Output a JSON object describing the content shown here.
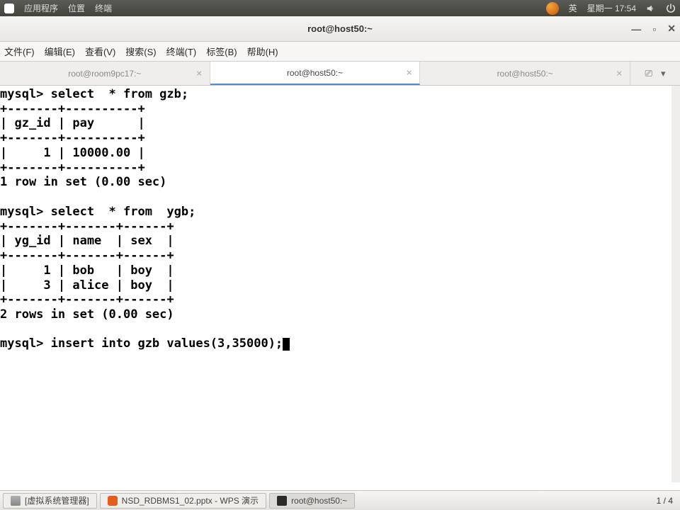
{
  "top_panel": {
    "apps": "应用程序",
    "places": "位置",
    "terminal": "终端",
    "ime": "英",
    "datetime": "星期一 17:54"
  },
  "window": {
    "title": "root@host50:~"
  },
  "menus": {
    "file": "文件(F)",
    "edit": "编辑(E)",
    "view": "查看(V)",
    "search": "搜索(S)",
    "terminal": "终端(T)",
    "tabs": "标签(B)",
    "help": "帮助(H)"
  },
  "tabs": [
    {
      "label": "root@room9pc17:~",
      "active": false
    },
    {
      "label": "root@host50:~",
      "active": true
    },
    {
      "label": "root@host50:~",
      "active": false
    }
  ],
  "terminal_lines": [
    "mysql> select  * from gzb;",
    "+-------+----------+",
    "| gz_id | pay      |",
    "+-------+----------+",
    "|     1 | 10000.00 |",
    "+-------+----------+",
    "1 row in set (0.00 sec)",
    "",
    "mysql> select  * from  ygb;",
    "+-------+-------+------+",
    "| yg_id | name  | sex  |",
    "+-------+-------+------+",
    "|     1 | bob   | boy  |",
    "|     3 | alice | boy  |",
    "+-------+-------+------+",
    "2 rows in set (0.00 sec)",
    "",
    "mysql> insert into gzb values(3,35000);"
  ],
  "taskbar": {
    "vm": "[虚拟系统管理器]",
    "wps": "NSD_RDBMS1_02.pptx - WPS 演示",
    "term": "root@host50:~",
    "workspace": "1 / 4"
  }
}
